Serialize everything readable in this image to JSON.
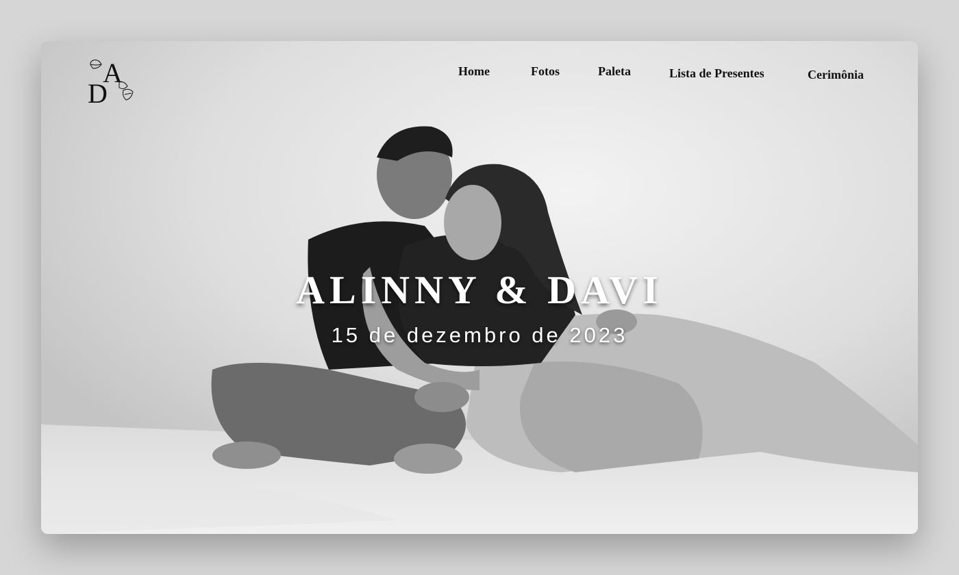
{
  "logo": {
    "monogram_top": "A",
    "monogram_bottom": "D",
    "icon": "floral-monogram-icon"
  },
  "nav": {
    "items": [
      {
        "label": "Home"
      },
      {
        "label": "Fotos"
      },
      {
        "label": "Paleta"
      },
      {
        "label": "Lista de Presentes"
      },
      {
        "label": "Cerimônia"
      }
    ]
  },
  "hero": {
    "title": "ALINNY & DAVI",
    "date": "15 de dezembro de 2023",
    "photo": "black-and-white couple photo"
  },
  "colors": {
    "page_background": "#d6d6d6",
    "nav_text": "#111111",
    "hero_text": "#ffffff"
  }
}
